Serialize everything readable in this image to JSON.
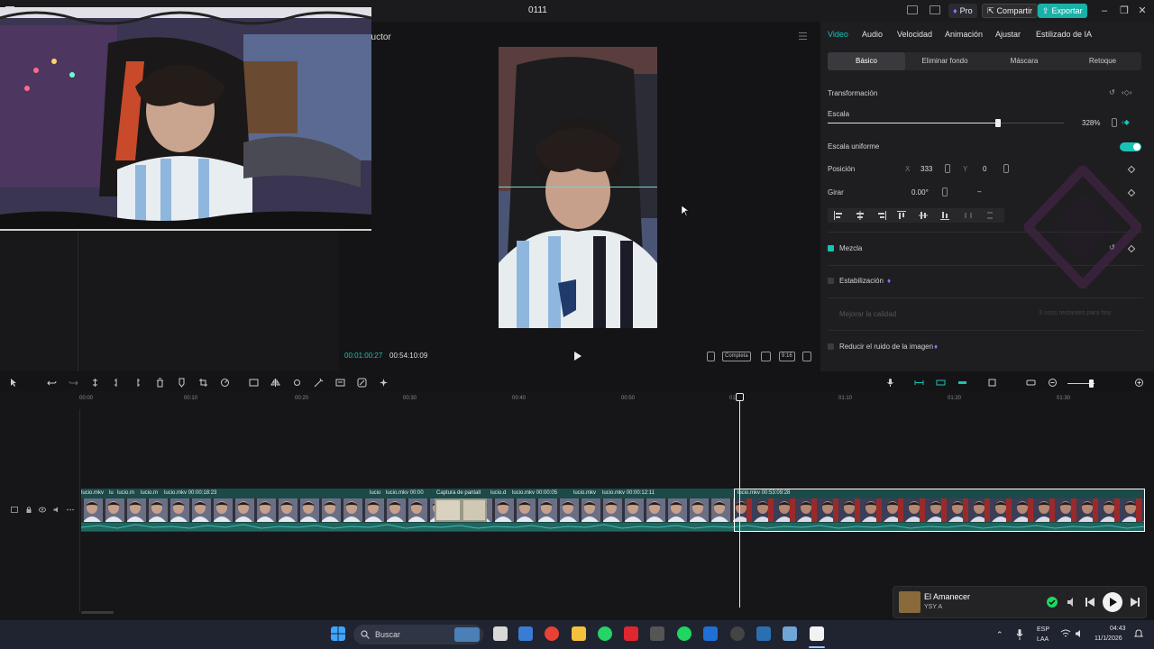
{
  "app": {
    "title": "0111",
    "pro_label": "Pro",
    "share_label": "Compartir",
    "export_label": "Exportar"
  },
  "player": {
    "label_partial": "ductor",
    "timecode_current": "00:01:00:27",
    "timecode_total": "00:54:10:09",
    "ratio_label": "Completa",
    "scale_label": "9:16"
  },
  "props": {
    "tabs": [
      "Video",
      "Audio",
      "Velocidad",
      "Animación",
      "Ajustar",
      "Estilizado de IA"
    ],
    "active_tab": "Video",
    "subtabs": [
      "Básico",
      "Eliminar fondo",
      "Máscara",
      "Retoque"
    ],
    "active_subtab": "Básico",
    "transform_label": "Transformación",
    "scale_label": "Escala",
    "scale_value": "328%",
    "scale_fraction": 0.72,
    "uniform_scale_label": "Escala uniforme",
    "position_label": "Posición",
    "pos_x_label": "X",
    "pos_x": "333",
    "pos_y_label": "Y",
    "pos_y": "0",
    "rotate_label": "Girar",
    "rotate_value": "0.00°",
    "rotate_dash": "–",
    "blend_label": "Mezcla",
    "stabilization_label": "Estabilización",
    "enhance_label": "Mejorar la calidad",
    "enhance_note": "3 usos restantes para hoy",
    "denoise_label": "Reducir el ruido de la imagen"
  },
  "timeline": {
    "ticks": [
      "00:00",
      "00:10",
      "00:20",
      "00:30",
      "00:40",
      "00:50",
      "01:00",
      "01:10",
      "01:20",
      "01:30"
    ],
    "clips": [
      {
        "label": "lucio.mkv"
      },
      {
        "label": "lu"
      },
      {
        "label": "lucio.m"
      },
      {
        "label": "lucio.m"
      },
      {
        "label": "lucio.mkv  00:00:18:23"
      },
      {
        "label": "lucio"
      },
      {
        "label": "lucio.mkv  00:00"
      },
      {
        "label": "Captura de pantall"
      },
      {
        "label": "lucio.d"
      },
      {
        "label": "lucio.mkv  00:00:05"
      },
      {
        "label": "lucio.mkv"
      },
      {
        "label": "lucio.mkv  00:00:12:11"
      },
      {
        "label": "lucio.mkv  00:53:09:28"
      }
    ]
  },
  "media": {
    "song": "El Amanecer",
    "artist": "YSY A"
  },
  "taskbar": {
    "search_placeholder": "Buscar",
    "lang_top": "ESP",
    "lang_bottom": "LAA",
    "time": "04:43",
    "date": "11/1/2026"
  },
  "colors": {
    "accent": "#19c3b4",
    "track": "#1b4a48",
    "background": "#141416"
  }
}
